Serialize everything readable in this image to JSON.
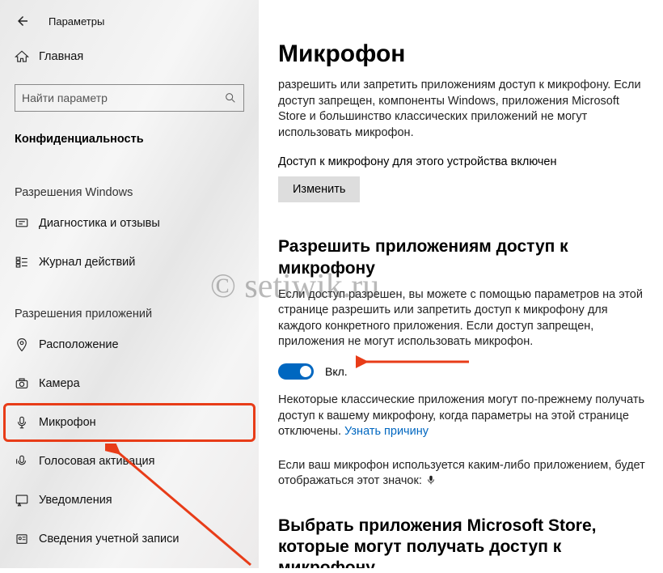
{
  "app": {
    "title": "Параметры"
  },
  "sidebar": {
    "home": "Главная",
    "search_placeholder": "Найти параметр",
    "current_section": "Конфиденциальность",
    "group1_title": "Разрешения Windows",
    "group1": [
      {
        "label": "Диагностика и отзывы"
      },
      {
        "label": "Журнал действий"
      }
    ],
    "group2_title": "Разрешения приложений",
    "group2": [
      {
        "label": "Расположение"
      },
      {
        "label": "Камера"
      },
      {
        "label": "Микрофон"
      },
      {
        "label": "Голосовая активация"
      },
      {
        "label": "Уведомления"
      },
      {
        "label": "Сведения учетной записи"
      }
    ]
  },
  "main": {
    "title": "Микрофон",
    "intro": "разрешить или запретить приложениям доступ к микрофону. Если доступ запрещен, компоненты Windows, приложения Microsoft Store и большинство классических приложений не могут использовать микрофон.",
    "device_status": "Доступ к микрофону для этого устройства включен",
    "change_button": "Изменить",
    "section1_title": "Разрешить приложениям доступ к микрофону",
    "section1_text": "Если доступ разрешен, вы можете с помощью параметров на этой странице разрешить или запретить доступ к микрофону для каждого конкретного приложения. Если доступ запрещен, приложения не могут использовать микрофон.",
    "toggle_label": "Вкл.",
    "classic_text": "Некоторые классические приложения могут по-прежнему получать доступ к вашему микрофону, когда параметры на этой странице отключены. ",
    "classic_link": "Узнать причину",
    "in_use_text": "Если ваш микрофон используется каким-либо приложением, будет отображаться этот значок: ",
    "section2_title": "Выбрать приложения Microsoft Store, которые могут получать доступ к микрофону"
  },
  "watermark": "© setiwik.ru"
}
